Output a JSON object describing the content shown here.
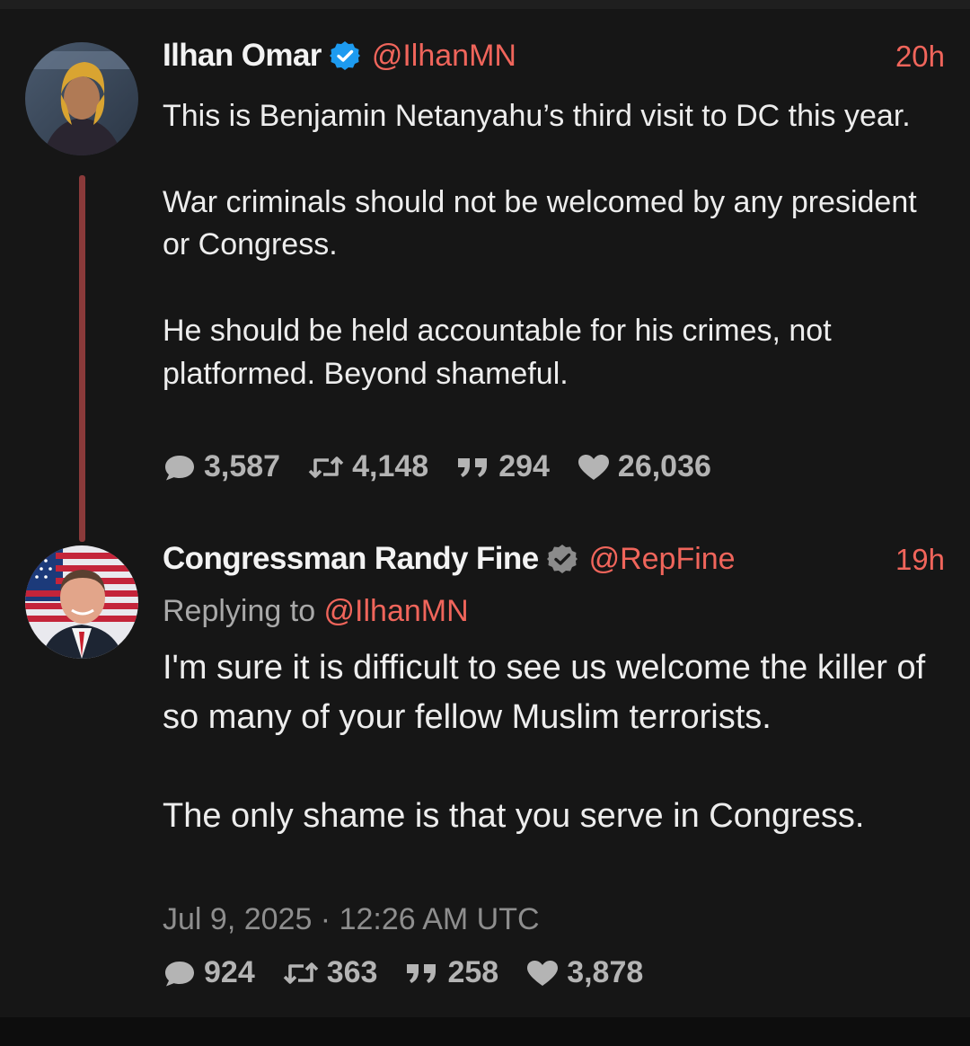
{
  "tweet1": {
    "name": "Ilhan Omar",
    "handle": "@IlhanMN",
    "time": "20h",
    "text": "This is Benjamin Netanyahu’s third visit to DC this year.\n\nWar criminals should not be welcomed by any president or Congress.\n\nHe should be held accountable for his crimes, not platformed. Beyond shameful.",
    "verified": "blue-verified-badge",
    "stats": {
      "comments": "3,587",
      "retweets": "4,148",
      "quotes": "294",
      "likes": "26,036"
    }
  },
  "tweet2": {
    "name": "Congressman Randy Fine",
    "handle": "@RepFine",
    "time": "19h",
    "replying_prefix": "Replying to ",
    "replying_handle": "@IlhanMN",
    "text": "I'm sure it is difficult to see us welcome the killer of so many of your fellow Muslim terrorists.\n\nThe only shame is that you serve in Congress.",
    "verified": "gray-verified-badge",
    "date": "Jul 9, 2025 · 12:26 AM UTC",
    "stats": {
      "comments": "924",
      "retweets": "363",
      "quotes": "258",
      "likes": "3,878"
    }
  },
  "colors": {
    "accent": "#f0655b",
    "background": "#161616",
    "verified_blue": "#1d9bf0",
    "verified_gray": "#8b8b8b",
    "thread_line": "#8a3a3a"
  },
  "icons": [
    "comment-icon",
    "retweet-icon",
    "quote-icon",
    "heart-icon"
  ]
}
